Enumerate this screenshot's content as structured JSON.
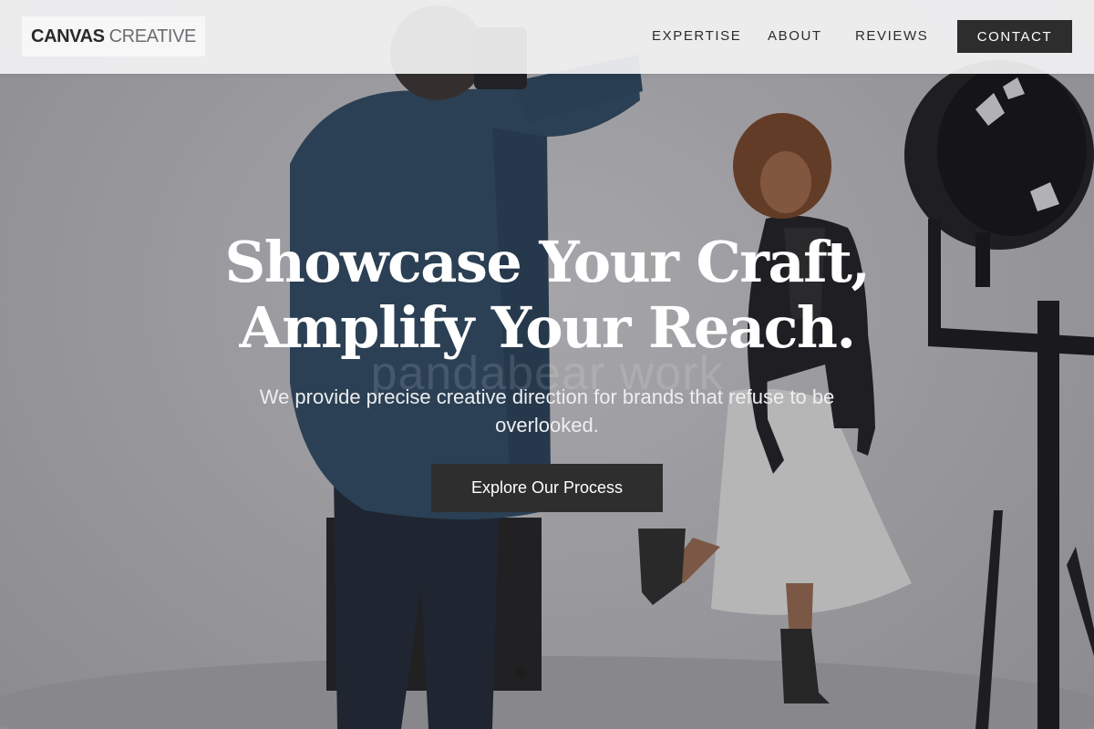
{
  "nav": {
    "logo": {
      "bold": "CANVAS",
      "light": "CREATIVE"
    },
    "links": [
      "EXPERTISE",
      "ABOUT",
      "REVIEWS"
    ],
    "cta": "CONTACT"
  },
  "hero": {
    "headline_line1": "Showcase Your Craft,",
    "headline_line2": "Amplify Your Reach.",
    "watermark": "pandabear work",
    "subhead": "We provide precise creative direction for brands that refuse to be overlooked.",
    "button": "Explore Our Process",
    "background": "photo-shoot-studio-image"
  },
  "colors": {
    "dark_button": "#2d2d2d",
    "nav_bg": "#f2f2f3",
    "text_white": "#ffffff"
  }
}
